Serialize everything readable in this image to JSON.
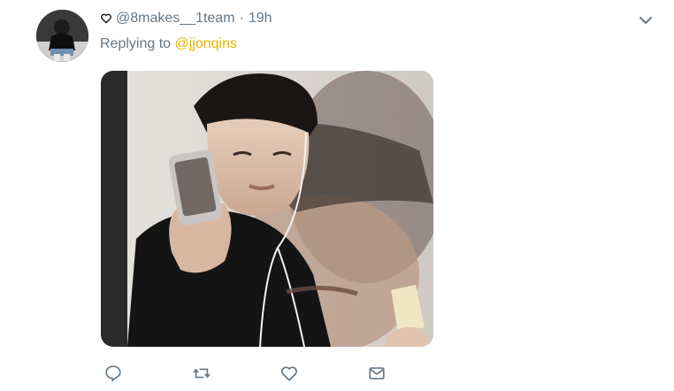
{
  "tweet": {
    "handle": "@8makes__1team",
    "separator": "·",
    "time": "19h",
    "replying_prefix": "Replying to",
    "replying_to": "@jjonqins"
  },
  "icons": {
    "handle_badge": "heart-outline-icon",
    "menu": "chevron-down-icon",
    "actions": [
      "reply-icon",
      "retweet-icon",
      "like-icon",
      "direct-message-icon"
    ]
  },
  "colors": {
    "secondary_text": "#657786",
    "mention": "#e8b400",
    "action_icons": "#657786",
    "caret": "#657786"
  }
}
